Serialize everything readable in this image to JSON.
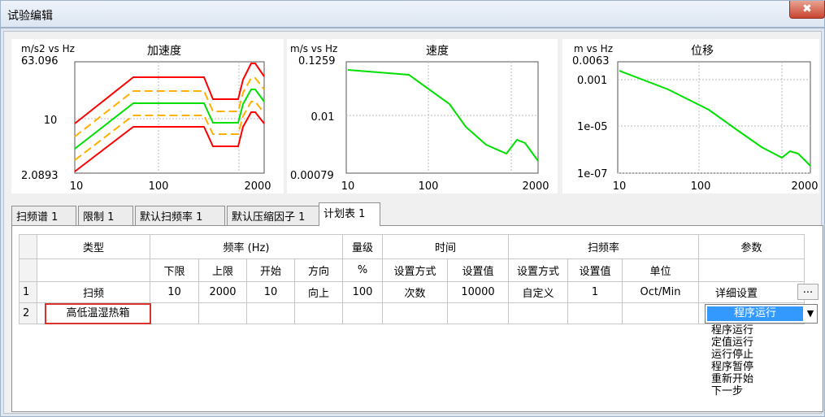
{
  "window": {
    "title": "试验编辑",
    "close_glyph": "✖"
  },
  "charts": [
    {
      "title": "加速度",
      "unit": "m/s2 vs Hz",
      "y_max_label": "63.096",
      "y_mid_label": "10",
      "y_min_label": "2.0893",
      "x_labels": [
        "10",
        "100",
        "2000"
      ]
    },
    {
      "title": "速度",
      "unit": "m/s vs Hz",
      "y_max_label": "0.1259",
      "y_mid_label": "0.01",
      "y_min_label": "0.00079",
      "x_labels": [
        "10",
        "100",
        "2000"
      ]
    },
    {
      "title": "位移",
      "unit": "m vs Hz",
      "y_max_label": "0.0063",
      "y_labels": [
        "0.001",
        "1e-05",
        "1e-07"
      ],
      "x_labels": [
        "10",
        "100",
        "2000"
      ]
    }
  ],
  "tabs": [
    "扫频谱 1",
    "限制 1",
    "默认扫频率 1",
    "默认压缩因子 1",
    "计划表 1"
  ],
  "table": {
    "group_headers": {
      "type": "类型",
      "frequency": "频率 (Hz)",
      "level": "量级",
      "time": "时间",
      "sweep_rate": "扫频率",
      "params": "参数"
    },
    "sub_headers": {
      "lower": "下限",
      "upper": "上限",
      "start": "开始",
      "direction": "方向",
      "percent": "%",
      "time_mode": "设置方式",
      "time_value": "设置值",
      "rate_mode": "设置方式",
      "rate_value": "设置值",
      "rate_unit": "单位"
    },
    "rows": [
      {
        "no": "1",
        "type": "扫频",
        "lower": "10",
        "upper": "2000",
        "start": "10",
        "direction": "向上",
        "percent": "100",
        "time_mode": "次数",
        "time_value": "10000",
        "rate_mode": "自定义",
        "rate_value": "1",
        "rate_unit": "Oct/Min",
        "params": "详细设置",
        "params_button": "..."
      },
      {
        "no": "2",
        "type": "高低温湿热箱"
      }
    ]
  },
  "combo": {
    "selected": "程序运行",
    "options": [
      "程序运行",
      "定值运行",
      "运行停止",
      "程序暂停",
      "重新开始",
      "下一步"
    ]
  },
  "colors": {
    "red_line": "#ff0000",
    "orange_dash": "#ffb000",
    "green_line": "#00e000",
    "combo_highlight": "#3399ff",
    "selected_border": "#d9332e"
  },
  "icons": {
    "dropdown_arrow": "▼"
  }
}
